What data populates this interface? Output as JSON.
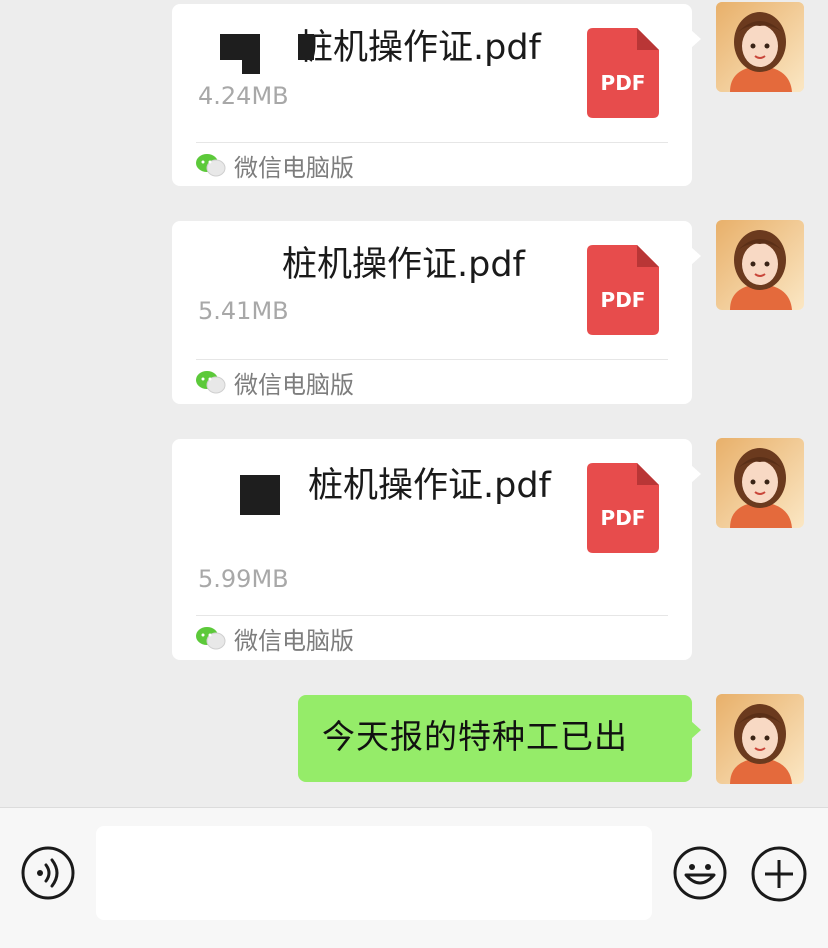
{
  "messages": [
    {
      "file_name": "桩机操作证.pdf",
      "file_size": "4.24MB",
      "source": "微信电脑版",
      "icon": "pdf-icon",
      "icon_label": "PDF"
    },
    {
      "file_name": "桩机操作证.pdf",
      "file_size": "5.41MB",
      "source": "微信电脑版",
      "icon": "pdf-icon",
      "icon_label": "PDF"
    },
    {
      "file_name": "桩机操作证.pdf",
      "file_size": "5.99MB",
      "source": "微信电脑版",
      "icon": "pdf-icon",
      "icon_label": "PDF"
    }
  ],
  "text_message": {
    "text": "今天报的特种工已出"
  },
  "input_bar": {
    "voice_icon": "voice-icon",
    "emoji_icon": "emoji-icon",
    "plus_icon": "plus-icon",
    "input_value": ""
  },
  "colors": {
    "background": "#ededed",
    "bubble_green": "#95ec69",
    "pdf_red": "#e74c4c",
    "wechat_green": "#5cc93a"
  }
}
